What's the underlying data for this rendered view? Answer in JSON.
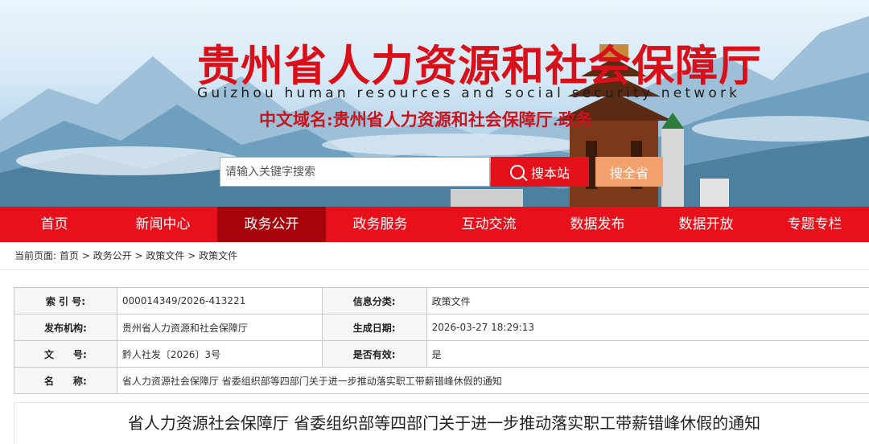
{
  "header": {
    "title": "贵州省人力资源和社会保障厅",
    "subtitle": "Guizhou human resources and social security network",
    "cn_domain": "中文域名:贵州省人力资源和社会保障厅.政务"
  },
  "search": {
    "placeholder": "请输入关键字搜索",
    "site_button": "搜本站",
    "province_button": "搜全省"
  },
  "nav": {
    "items": [
      "首页",
      "新闻中心",
      "政务公开",
      "政务服务",
      "互动交流",
      "数据发布",
      "数据开放",
      "专题专栏"
    ],
    "active": "政务公开"
  },
  "breadcrumb": {
    "prefix": "当前页面:",
    "items": [
      "首页",
      "政务公开",
      "政策文件",
      "政策文件"
    ],
    "separator": ">"
  },
  "info": {
    "index_label": "索 引 号:",
    "index_value": "000014349/2026-413221",
    "category_label": "信息分类:",
    "category_value": "政策文件",
    "issuer_label": "发布机构:",
    "issuer_value": "贵州省人力资源和社会保障厅",
    "date_label": "生成日期:",
    "date_value": "2026-03-27 18:29:13",
    "docno_label": "文　　号:",
    "docno_value": "黔人社发〔2026〕3号",
    "valid_label": "是否有效:",
    "valid_value": "是",
    "name_label": "名　　称:",
    "name_value": "省人力资源社会保障厅 省委组织部等四部门关于进一步推动落实职工带薪错峰休假的通知"
  },
  "document": {
    "title": "省人力资源社会保障厅 省委组织部等四部门关于进一步推动落实职工带薪错峰休假的通知"
  },
  "colors": {
    "brand_red": "#e8101b",
    "nav_active": "#a6030b",
    "province_button": "#f4a06c"
  }
}
